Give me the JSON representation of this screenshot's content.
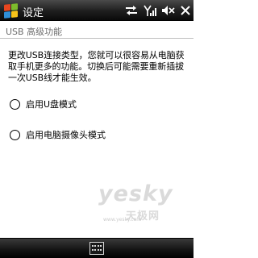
{
  "status_bar": {
    "title": "设定",
    "start_icon": "windows-flag-icon",
    "icons": [
      "sync-arrows-icon",
      "signal-strength-icon",
      "volume-muted-icon",
      "close-icon"
    ]
  },
  "page": {
    "title": "USB 高级功能"
  },
  "content": {
    "description": "更改USB连接类型，您就可以很容易从电脑获取手机更多的功能。切换后可能需要重新插拔一次USB线才能生效。"
  },
  "options": [
    {
      "label": "启用U盘模式",
      "selected": false
    },
    {
      "label": "启用电脑摄像头模式",
      "selected": false
    }
  ],
  "watermark": {
    "logo_text": "yesky",
    "cn_text": "天极网",
    "en_text": "www.yesky.com"
  },
  "bottom_bar": {
    "keyboard_icon": "keyboard-icon"
  },
  "colors": {
    "bar_dark": "#111111",
    "header_text": "#6e6e6e",
    "divider": "#bfbfbf",
    "flag_red": "#e8461f",
    "flag_green": "#7dbb2c",
    "flag_blue": "#2f8fd8",
    "flag_yellow": "#f7c31a"
  }
}
